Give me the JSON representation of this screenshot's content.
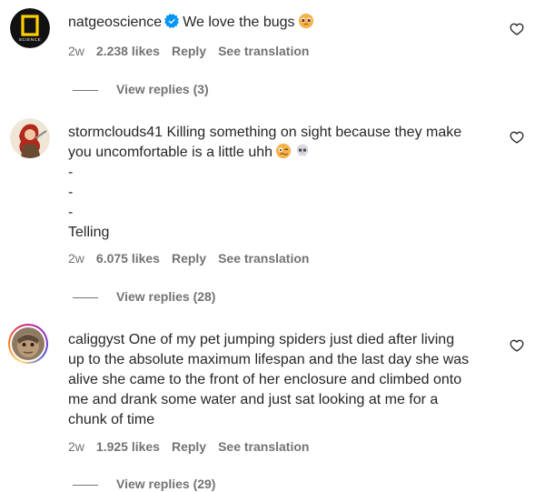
{
  "comments": [
    {
      "username": "natgeoscience",
      "verified": true,
      "text": "We love the bugs",
      "emoji": "pleading-face",
      "time": "2w",
      "likes": "2.238 likes",
      "reply_label": "Reply",
      "translate_label": "See translation",
      "view_replies": "View replies (3)"
    },
    {
      "username": "stormclouds41",
      "text_line1": "Killing something on sight because they make",
      "text_line2": "you uncomfortable is a little uhh",
      "emoji": [
        "woozy-face",
        "skull"
      ],
      "dash1": "-",
      "dash2": "-",
      "dash3": "-",
      "text_line6": "Telling",
      "time": "2w",
      "likes": "6.075 likes",
      "reply_label": "Reply",
      "translate_label": "See translation",
      "view_replies": "View replies (28)"
    },
    {
      "username": "caliggyst",
      "text_line1": "One of my pet jumping spiders just died after living",
      "text_line2": "up to the absolute maximum lifespan and the last day she was",
      "text_line3": "alive she came to the front of her enclosure and climbed onto",
      "text_line4": "me and drank some water and just sat looking at me for a",
      "text_line5": "chunk of time",
      "time": "2w",
      "likes": "1.925 likes",
      "reply_label": "Reply",
      "translate_label": "See translation",
      "view_replies": "View replies (29)"
    }
  ],
  "natgeo_logo_text": "SCIENCE",
  "colors": {
    "text": "#262626",
    "muted": "#737373",
    "verified": "#0095f6",
    "natgeo_yellow": "#ffce00"
  }
}
